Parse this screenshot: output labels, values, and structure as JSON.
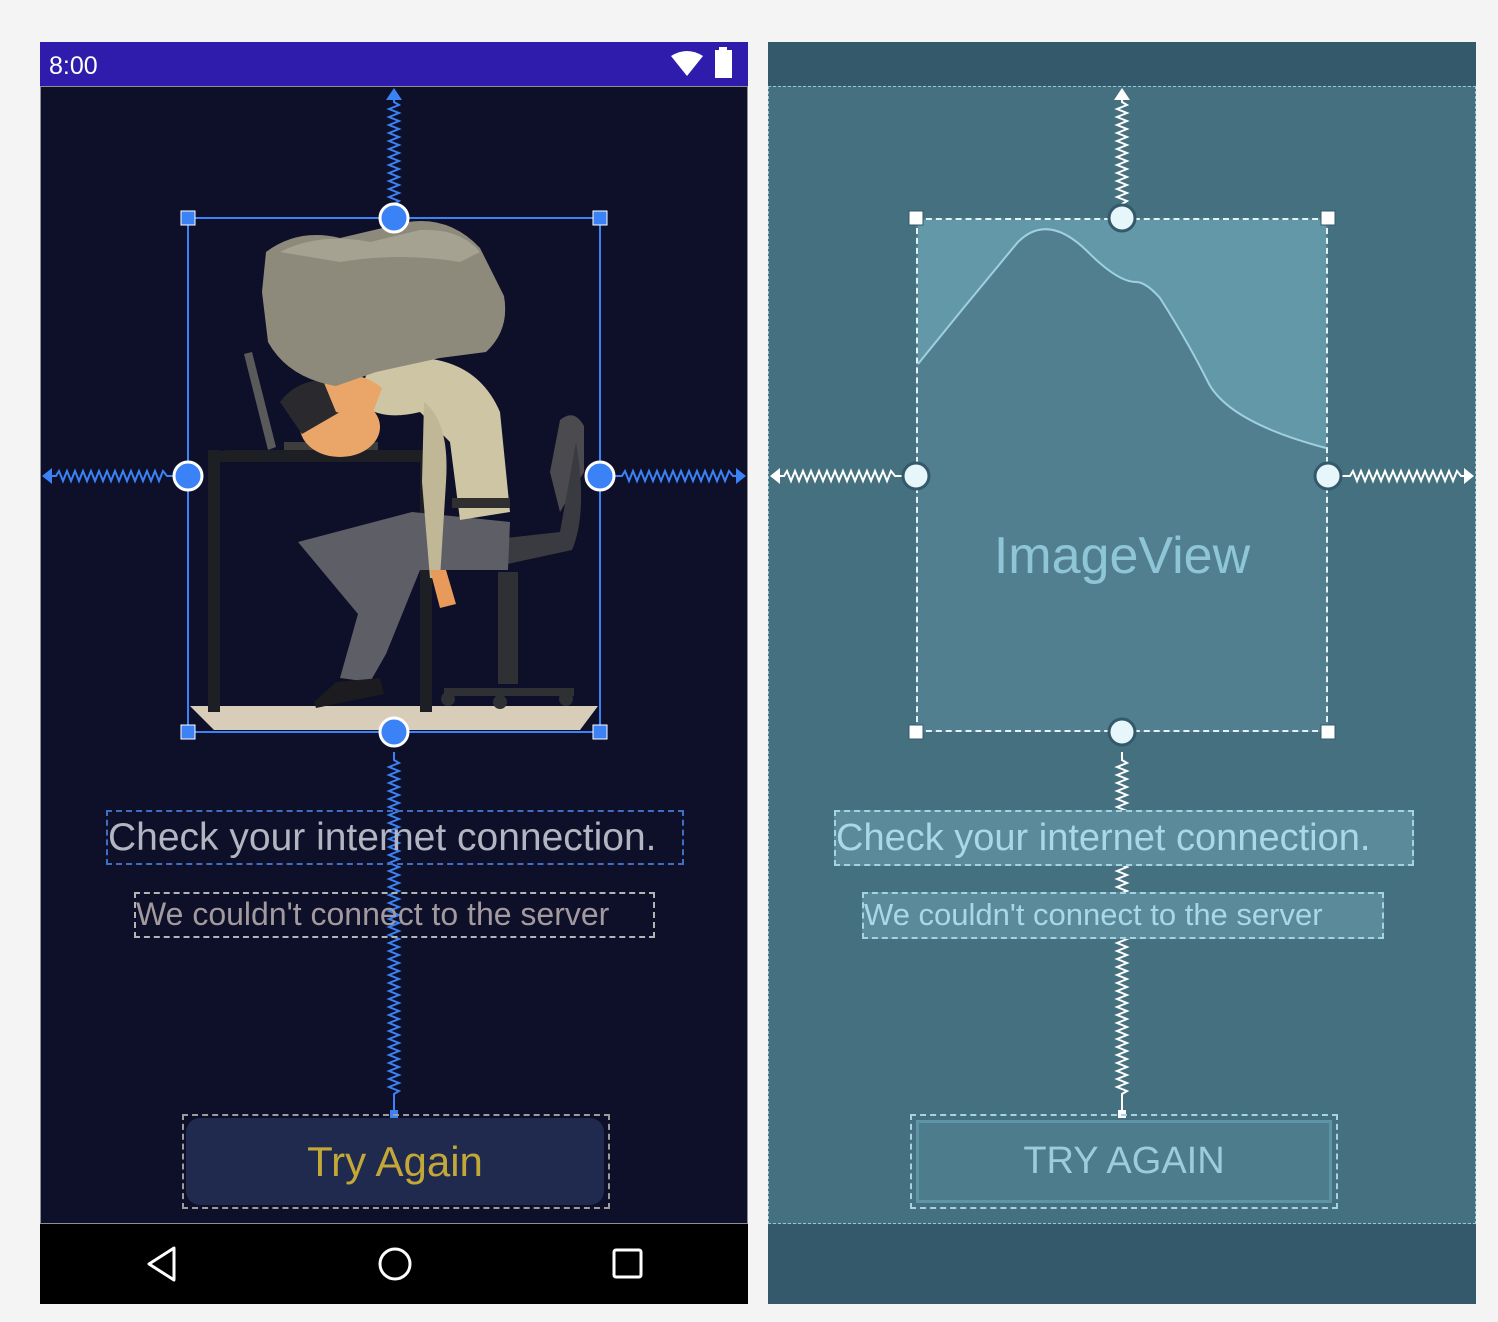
{
  "status_bar": {
    "time": "8:00",
    "icons": [
      "wifi-icon",
      "battery-icon"
    ]
  },
  "nav_bar": {
    "icons": [
      "back-icon",
      "home-icon",
      "recents-icon"
    ]
  },
  "design": {
    "title": "Check your internet connection.",
    "subtitle": "We couldn't connect to the server",
    "button_label": "Try Again",
    "colors": {
      "background": "#0e0f28",
      "status_bar": "#2f1bac",
      "button_bg": "#1f2a4e",
      "button_text": "#c3a838",
      "selection": "#3b82f6"
    }
  },
  "blueprint": {
    "image_label": "ImageView",
    "title": "Check your internet connection.",
    "subtitle": "We couldn't connect to the server",
    "button_label": "TRY AGAIN",
    "colors": {
      "background": "#44707f",
      "frame": "#33596a"
    }
  }
}
